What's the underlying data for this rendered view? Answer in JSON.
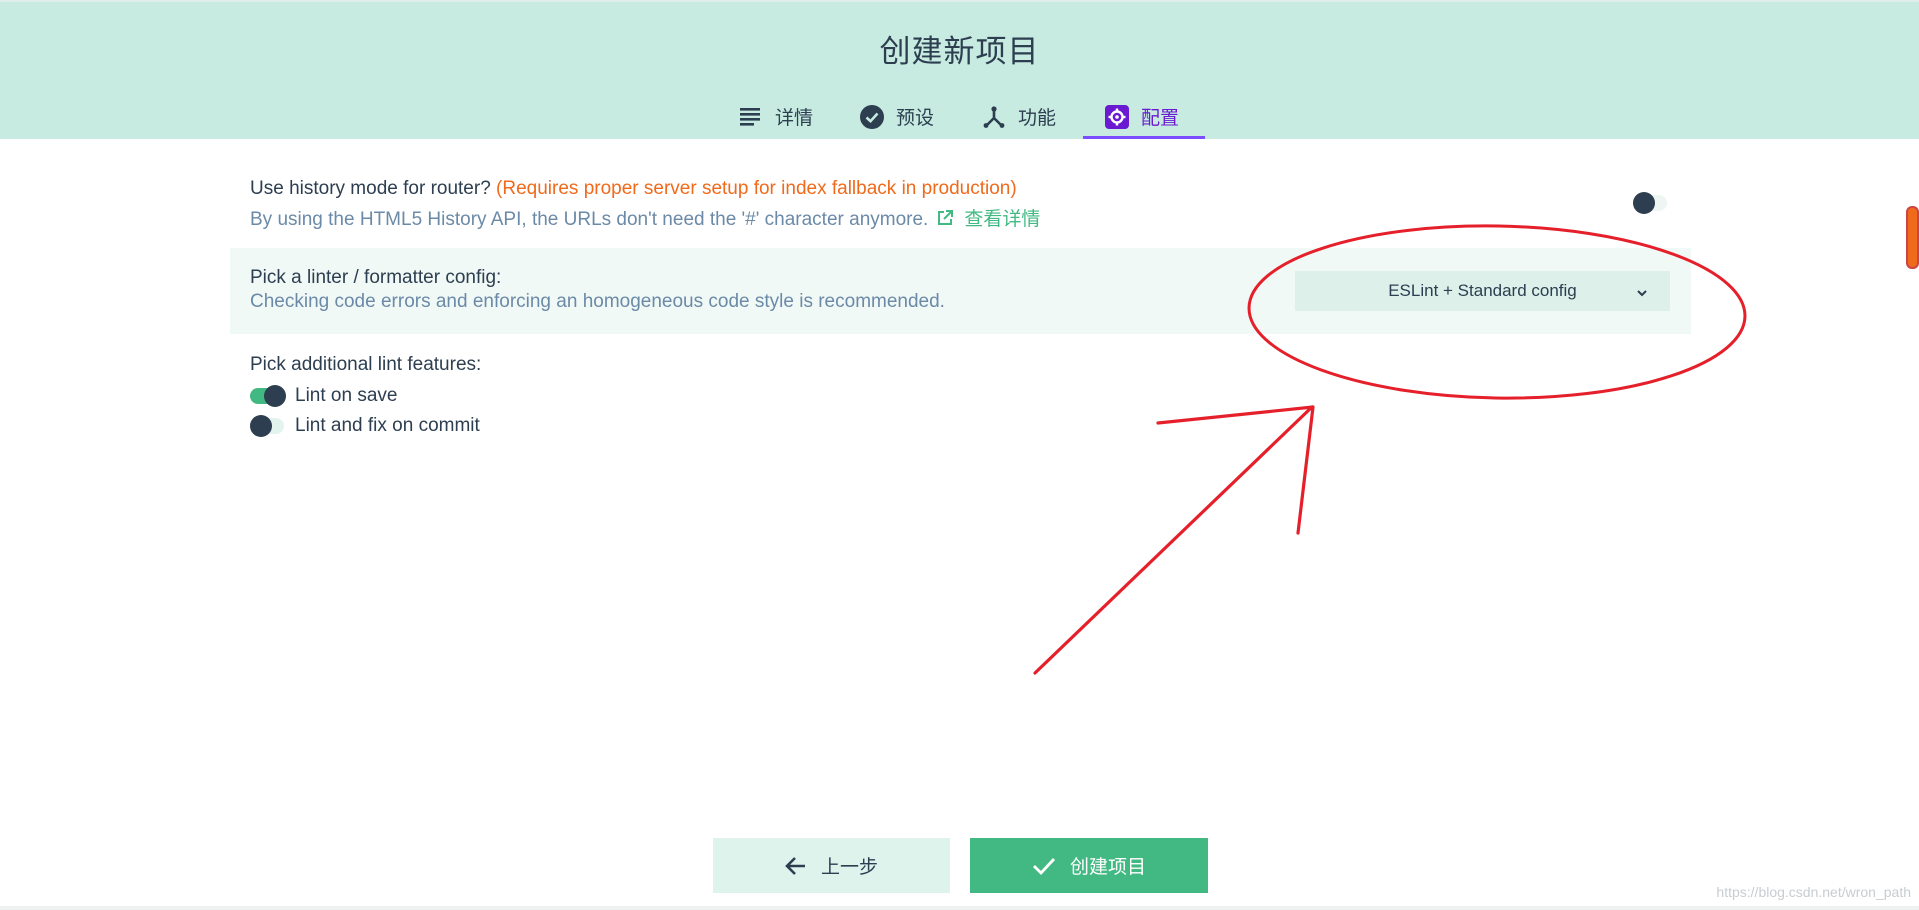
{
  "header": {
    "title": "创建新项目",
    "tabs": [
      {
        "label": "详情",
        "icon": "list-icon",
        "active": false
      },
      {
        "label": "预设",
        "icon": "check-circle-icon",
        "active": false
      },
      {
        "label": "功能",
        "icon": "fork-icon",
        "active": false
      },
      {
        "label": "配置",
        "icon": "gear-icon",
        "active": true
      }
    ]
  },
  "router": {
    "label": "Use history mode for router?",
    "warning": "(Requires proper server setup for index fallback in production)",
    "description": "By using the HTML5 History API, the URLs don't need the '#' character anymore.",
    "link": "查看详情",
    "enabled": false
  },
  "linter": {
    "label": "Pick a linter / formatter config:",
    "description": "Checking code errors and enforcing an homogeneous code style is recommended.",
    "selected": "ESLint + Standard config"
  },
  "lint_features": {
    "label": "Pick additional lint features:",
    "items": [
      {
        "label": "Lint on save",
        "enabled": true
      },
      {
        "label": "Lint and fix on commit",
        "enabled": false
      }
    ]
  },
  "footer": {
    "prev_label": "上一步",
    "create_label": "创建项目"
  },
  "watermark": "https://blog.csdn.net/wron_path",
  "colors": {
    "header_bg": "#c7ebe0",
    "accent_green": "#42b983",
    "active_tab": "#7c4dff",
    "warning": "#f06a1b",
    "annotation": "#e5202b"
  }
}
